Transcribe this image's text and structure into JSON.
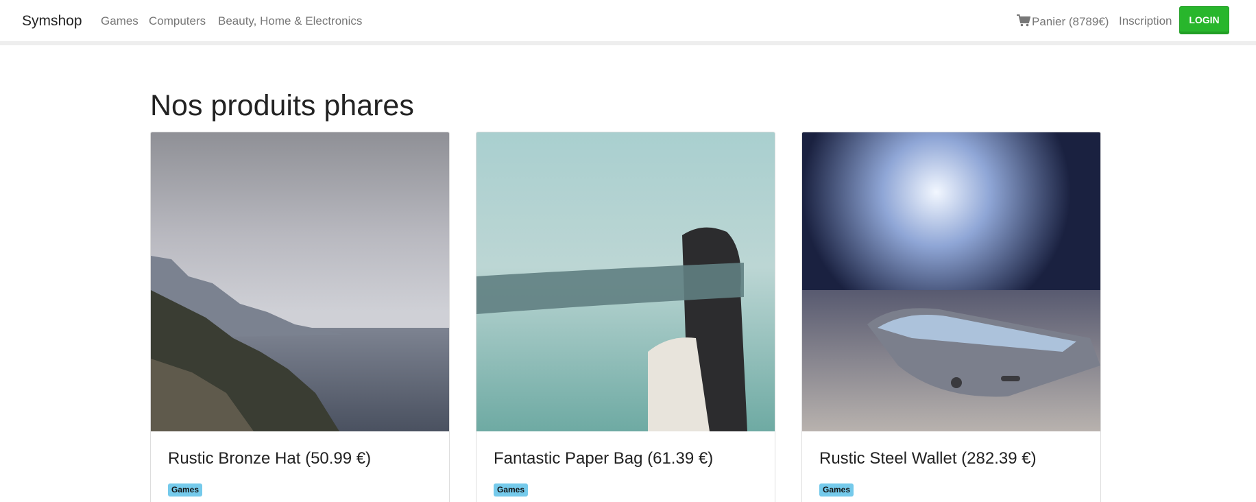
{
  "navbar": {
    "brand": "Symshop",
    "links": [
      "Games",
      "Computers",
      "Beauty, Home & Electronics"
    ],
    "cart_label": "Panier (8789€)",
    "signup_label": "Inscription",
    "login_label": "LOGIN"
  },
  "main": {
    "title": "Nos produits phares",
    "products": [
      {
        "title": "Rustic Bronze Hat (50.99 €)",
        "category": "Games"
      },
      {
        "title": "Fantastic Paper Bag (61.39 €)",
        "category": "Games"
      },
      {
        "title": "Rustic Steel Wallet (282.39 €)",
        "category": "Games"
      }
    ]
  },
  "colors": {
    "accent_green": "#28b62c",
    "badge_blue": "#75caeb",
    "nav_text": "#777777"
  },
  "icons": {
    "cart": "shopping-cart-icon"
  }
}
